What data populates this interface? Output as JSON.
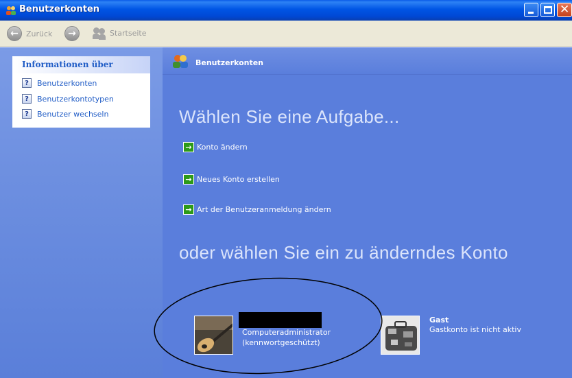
{
  "window": {
    "title": "Benutzerkonten",
    "icon": "users-icon"
  },
  "toolbar": {
    "back_label": "Zurück",
    "home_label": "Startseite"
  },
  "sidebar": {
    "heading": "Informationen über",
    "links": [
      {
        "label": "Benutzerkonten",
        "icon": "help-icon"
      },
      {
        "label": "Benutzerkontotypen",
        "icon": "help-icon"
      },
      {
        "label": "Benutzer wechseln",
        "icon": "help-icon"
      }
    ]
  },
  "main": {
    "header_title": "Benutzerkonten",
    "task_heading": "Wählen Sie eine Aufgabe...",
    "tasks": [
      {
        "label": "Konto ändern"
      },
      {
        "label": "Neues Konto erstellen"
      },
      {
        "label": "Art der Benutzeranmeldung ändern"
      }
    ],
    "account_heading": "oder wählen Sie ein zu änderndes Konto",
    "accounts": [
      {
        "name": "",
        "role": "Computeradministrator",
        "status": "(kennwortgeschützt)",
        "picture": "guitar-picture"
      },
      {
        "name": "Gast",
        "role": "",
        "status": "Gastkonto ist nicht aktiv",
        "picture": "suitcase-picture"
      }
    ]
  },
  "colors": {
    "titlebar": "#0055e5",
    "sidebar": "#6d8fe0",
    "main": "#5a7edc",
    "link": "#215dc6",
    "task_arrow": "#2d9a18"
  }
}
